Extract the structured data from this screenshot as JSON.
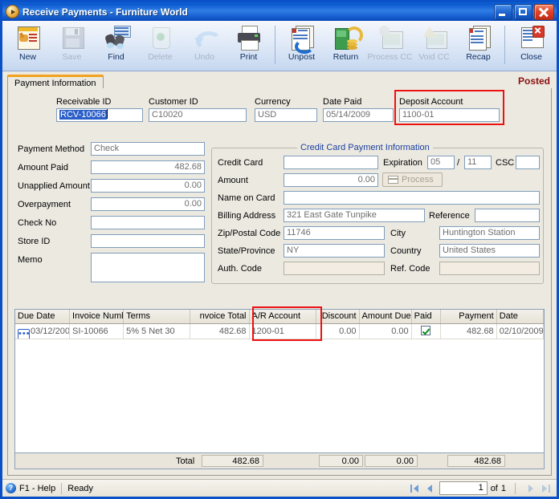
{
  "window": {
    "title": "Receive Payments - Furniture World",
    "icon": "play-circle-icon",
    "buttons": {
      "minimize": "minimize-icon",
      "maximize": "maximize-icon",
      "close": "close-icon"
    }
  },
  "toolbar": [
    {
      "label": "New",
      "icon": "new-document-icon",
      "enabled": true
    },
    {
      "label": "Save",
      "icon": "floppy-disk-icon",
      "enabled": false
    },
    {
      "label": "Find",
      "icon": "binoculars-icon",
      "enabled": true
    },
    {
      "label": "Delete",
      "icon": "recycle-bin-icon",
      "enabled": false
    },
    {
      "label": "Undo",
      "icon": "undo-arrow-icon",
      "enabled": false
    },
    {
      "label": "Print",
      "icon": "printer-icon",
      "enabled": true
    },
    {
      "label": "Unpost",
      "icon": "unpost-icon",
      "enabled": true
    },
    {
      "label": "Return",
      "icon": "return-money-icon",
      "enabled": true
    },
    {
      "label": "Process CC",
      "icon": "process-cc-icon",
      "enabled": false
    },
    {
      "label": "Void CC",
      "icon": "void-cc-icon",
      "enabled": false
    },
    {
      "label": "Recap",
      "icon": "recap-icon",
      "enabled": true
    },
    {
      "label": "Close",
      "icon": "close-window-icon",
      "enabled": true
    }
  ],
  "tab": {
    "label": "Payment Information"
  },
  "status_flag": "Posted",
  "header_fields": [
    {
      "label": "Receivable ID",
      "value": "RCV-10066",
      "selected": true
    },
    {
      "label": "Customer ID",
      "value": "C10020",
      "selected": false
    },
    {
      "label": "Currency",
      "value": "USD",
      "selected": false
    },
    {
      "label": "Date Paid",
      "value": "05/14/2009",
      "selected": false
    },
    {
      "label": "Deposit Account",
      "value": "1100-01",
      "selected": false,
      "highlighted": true
    }
  ],
  "payment_fields": [
    {
      "label": "Payment Method",
      "value": "Check",
      "align": "left"
    },
    {
      "label": "Amount Paid",
      "value": "482.68",
      "align": "right"
    },
    {
      "label": "Unapplied Amount",
      "value": "0.00",
      "align": "right"
    },
    {
      "label": "Overpayment",
      "value": "0.00",
      "align": "right"
    },
    {
      "label": "Check No",
      "value": "",
      "align": "left"
    },
    {
      "label": "Store ID",
      "value": "",
      "align": "left"
    },
    {
      "label": "Memo",
      "value": "",
      "align": "left"
    }
  ],
  "credit_card": {
    "title": "Credit Card Payment Information",
    "credit_card_label": "Credit Card",
    "credit_card_value": "",
    "expiration_label": "Expiration",
    "expiration_month": "05",
    "expiration_separator": "/",
    "expiration_year": "11",
    "csc_label": "CSC",
    "csc_value": "",
    "amount_label": "Amount",
    "amount_value": "0.00",
    "process_button": "Process",
    "name_on_card_label": "Name on Card",
    "name_on_card_value": "",
    "billing_address_label": "Billing Address",
    "billing_address_value": "321 East Gate Tunpike",
    "reference_label": "Reference",
    "reference_value": "",
    "zip_label": "Zip/Postal Code",
    "zip_value": "11746",
    "city_label": "City",
    "city_value": "Huntington Station",
    "state_label": "State/Province",
    "state_value": "NY",
    "country_label": "Country",
    "country_value": "United States",
    "auth_code_label": "Auth. Code",
    "auth_code_value": "",
    "ref_code_label": "Ref. Code",
    "ref_code_value": ""
  },
  "grid": {
    "columns": [
      {
        "label": "Due Date",
        "align": "left"
      },
      {
        "label": "Invoice Numb",
        "align": "left"
      },
      {
        "label": "Terms",
        "align": "left"
      },
      {
        "label": "nvoice Total",
        "align": "right"
      },
      {
        "label": "A/R Account",
        "align": "left"
      },
      {
        "label": "Discount",
        "align": "right"
      },
      {
        "label": "Amount Due",
        "align": "right"
      },
      {
        "label": "Paid",
        "align": "left"
      },
      {
        "label": "Payment",
        "align": "right"
      },
      {
        "label": "Date",
        "align": "left"
      }
    ],
    "rows": [
      {
        "due_date": "03/12/200",
        "invoice_number": "SI-10066",
        "terms": "5% 5 Net 30",
        "invoice_total": "482.68",
        "ar_account": "1200-01",
        "discount": "0.00",
        "amount_due": "0.00",
        "paid": true,
        "payment": "482.68",
        "date": "02/10/2009"
      }
    ],
    "totals": {
      "label": "Total",
      "invoice_total": "482.68",
      "discount": "0.00",
      "amount_due": "0.00",
      "payment": "482.68"
    },
    "highlighted_column": "A/R Account"
  },
  "statusbar": {
    "help": "F1 - Help",
    "state": "Ready",
    "page": "1",
    "of": "of",
    "total_pages": "1",
    "nav": [
      "first-page-icon",
      "previous-page-icon",
      "next-page-icon",
      "last-page-icon"
    ]
  },
  "colors": {
    "title_blue": "#0a57cd",
    "accent_orange": "#f0a21e",
    "posted_red": "#8b0f0f",
    "highlight_red": "#ee1111",
    "selection_blue": "#2a5ec8",
    "form_bg": "#ece9e1"
  }
}
